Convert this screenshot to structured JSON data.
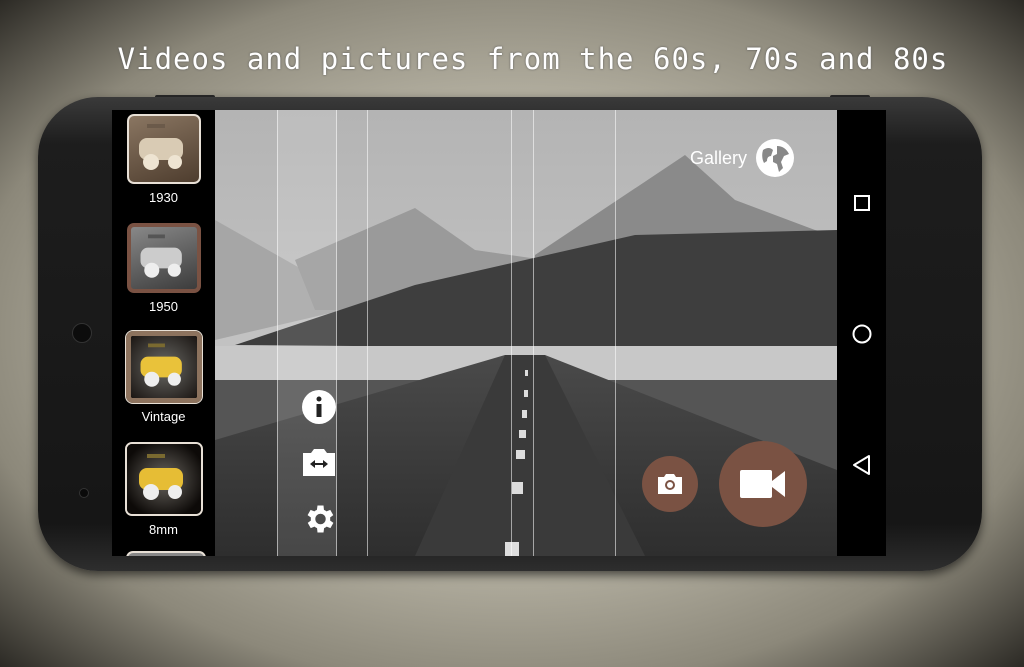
{
  "headline": "Videos and pictures from the 60s, 70s and 80s",
  "colors": {
    "accent": "#7a5243",
    "frame": "#8d735e"
  },
  "filters": [
    {
      "name": "1930",
      "tone": "sepia",
      "selected": false
    },
    {
      "name": "1950",
      "tone": "grayscale",
      "selected": true
    },
    {
      "name": "Vintage",
      "tone": "yellow",
      "selected": false
    },
    {
      "name": "8mm",
      "tone": "yellow",
      "selected": false
    }
  ],
  "camera": {
    "gallery_label": "Gallery",
    "gallery_icon": "globe-icon",
    "left_controls": [
      "info-icon",
      "switch-camera-icon",
      "settings-icon"
    ],
    "photo_button_icon": "camera-icon",
    "video_button_icon": "videocam-icon"
  },
  "navbar": [
    "recents-icon",
    "home-icon",
    "back-icon"
  ]
}
